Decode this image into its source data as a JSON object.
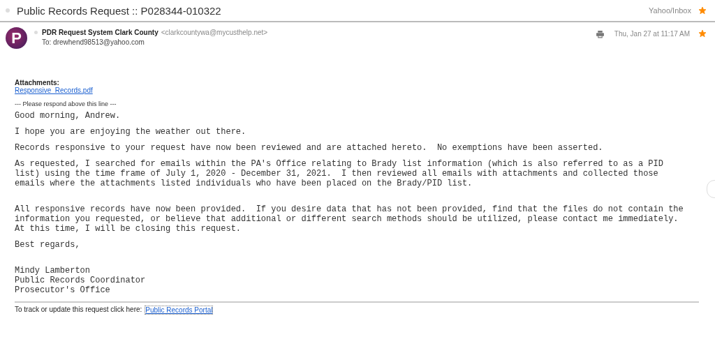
{
  "subject": {
    "title": "Public Records Request :: P028344-010322",
    "unread": false,
    "folder": "Yahoo/Inbox",
    "starred": true
  },
  "message": {
    "avatar_letter": "P",
    "unread": false,
    "sender_name": "PDR Request System Clark County",
    "sender_email": "<clarkcountywa@mycusthelp.net>",
    "to": "To: drewhend98513@yahoo.com",
    "date": "Thu, Jan 27 at 11:17 AM",
    "starred": true
  },
  "attachments": {
    "label": "Attachments:",
    "files": [
      "Responsive_Records.pdf"
    ]
  },
  "respond_line": "--- Please respond above this line ---",
  "paragraphs": [
    "Good morning, Andrew.",
    "I hope you are enjoying the weather out there.",
    "Records responsive to your request have now been reviewed and are attached hereto.  No exemptions have been asserted.",
    "As requested, I searched for emails within the PA's Office relating to Brady list information (which is also referred to as a PID\nlist) using the time frame of July 1, 2020 - December 31, 2021.  I then reviewed all emails with attachments and collected those\nemails where the attachments listed individuals who have been placed on the Brady/PID list.\n ",
    "All responsive records have now been provided.  If you desire data that has not been provided, find that the files do not contain the\ninformation you requested, or believe that additional or different search methods should be utilized, please contact me immediately.\nAt this time, I will be closing this request.",
    "Best regards,\n ",
    "Mindy Lamberton\nPublic Records Coordinator\nProsecutor's Office"
  ],
  "footer": {
    "text": "To track or update this request click here:",
    "link": "Public Records Portal"
  }
}
